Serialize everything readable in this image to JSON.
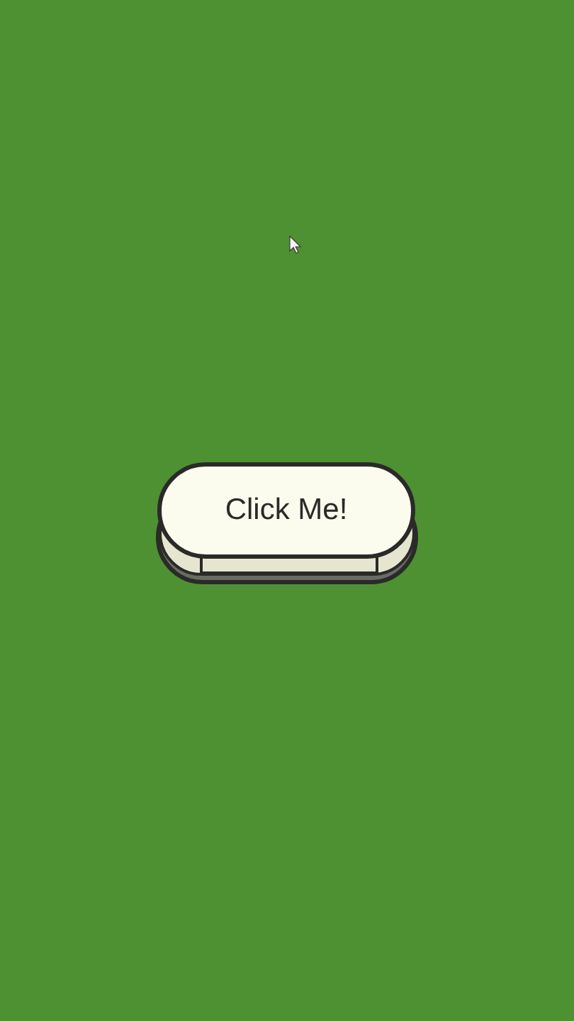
{
  "button": {
    "label": "Click Me!"
  }
}
